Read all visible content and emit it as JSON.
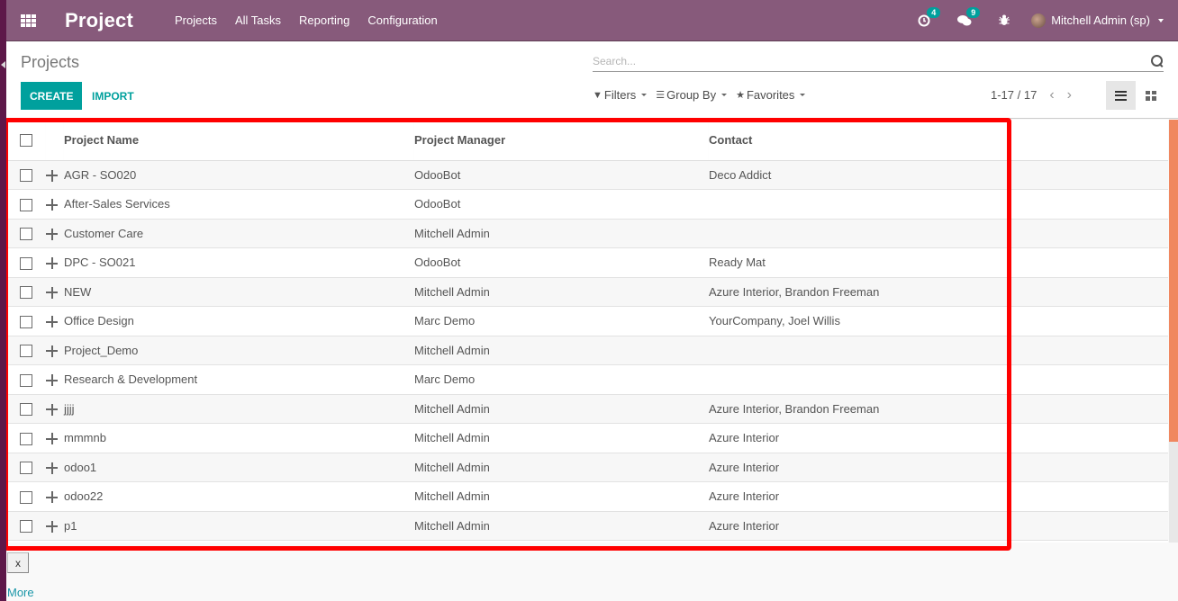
{
  "navbar": {
    "app_title": "Project",
    "menu": [
      "Projects",
      "All Tasks",
      "Reporting",
      "Configuration"
    ],
    "activity_count": "4",
    "messages_count": "9",
    "user_name": "Mitchell Admin (sp)",
    "icons": {
      "apps": "apps-grid-icon",
      "activity": "clock-icon",
      "messages": "chat-icon",
      "debug": "bug-icon"
    }
  },
  "control": {
    "breadcrumb": "Projects",
    "create_label": "CREATE",
    "import_label": "IMPORT",
    "search_placeholder": "Search...",
    "filters_label": "Filters",
    "groupby_label": "Group By",
    "favorites_label": "Favorites",
    "pager": "1-17 / 17"
  },
  "table": {
    "headers": [
      "Project Name",
      "Project Manager",
      "Contact"
    ],
    "rows": [
      {
        "name": "AGR - SO020",
        "manager": "OdooBot",
        "contact": "Deco Addict"
      },
      {
        "name": "After-Sales Services",
        "manager": "OdooBot",
        "contact": ""
      },
      {
        "name": "Customer Care",
        "manager": "Mitchell Admin",
        "contact": ""
      },
      {
        "name": "DPC - SO021",
        "manager": "OdooBot",
        "contact": "Ready Mat"
      },
      {
        "name": "NEW",
        "manager": "Mitchell Admin",
        "contact": "Azure Interior, Brandon Freeman"
      },
      {
        "name": "Office Design",
        "manager": "Marc Demo",
        "contact": "YourCompany, Joel Willis"
      },
      {
        "name": "Project_Demo",
        "manager": "Mitchell Admin",
        "contact": ""
      },
      {
        "name": "Research & Development",
        "manager": "Marc Demo",
        "contact": ""
      },
      {
        "name": "jjjj",
        "manager": "Mitchell Admin",
        "contact": "Azure Interior, Brandon Freeman"
      },
      {
        "name": "mmmnb",
        "manager": "Mitchell Admin",
        "contact": "Azure Interior"
      },
      {
        "name": "odoo1",
        "manager": "Mitchell Admin",
        "contact": "Azure Interior"
      },
      {
        "name": "odoo22",
        "manager": "Mitchell Admin",
        "contact": "Azure Interior"
      },
      {
        "name": "p1",
        "manager": "Mitchell Admin",
        "contact": "Azure Interior"
      }
    ]
  },
  "footer": {
    "close_label": "x",
    "more_label": "More"
  },
  "colors": {
    "navbar": "#875a7b",
    "primary": "#00a09d",
    "highlight": "#ff0000",
    "scroll_thumb": "#f0875f"
  }
}
